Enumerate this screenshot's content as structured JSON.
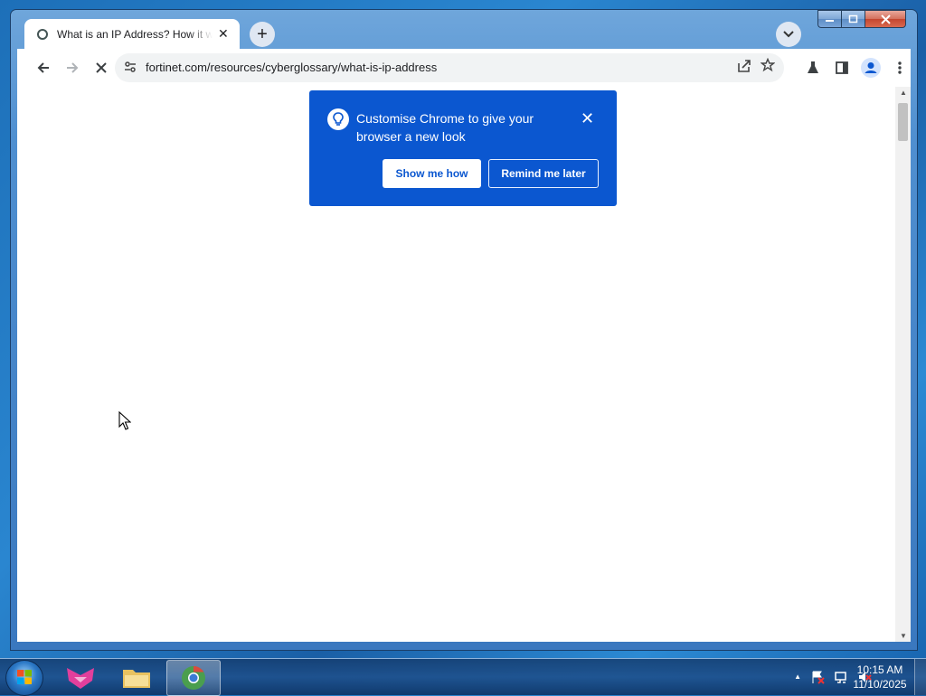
{
  "browser": {
    "tab": {
      "title": "What is an IP Address? How it works",
      "close_glyph": "✕"
    },
    "new_tab_glyph": "+",
    "address": {
      "url": "fortinet.com/resources/cyberglossary/what-is-ip-address"
    }
  },
  "promo": {
    "message": "Customise Chrome to give your browser a new look",
    "close_glyph": "✕",
    "primary_label": "Show me how",
    "secondary_label": "Remind me later",
    "color": "#0b57d0"
  },
  "taskbar": {
    "clock_time": "10:15 AM",
    "clock_date": "11/10/2025",
    "tray_glyph": "▲"
  },
  "colors": {
    "accent": "#0b57d0"
  },
  "icons": [
    "back-arrow-icon",
    "forward-arrow-icon",
    "stop-loading-icon",
    "site-info-icon",
    "share-icon",
    "star-icon",
    "labs-icon",
    "side-panel-icon",
    "profile-icon",
    "menu-icon",
    "tab-search-icon",
    "bulb-icon"
  ]
}
